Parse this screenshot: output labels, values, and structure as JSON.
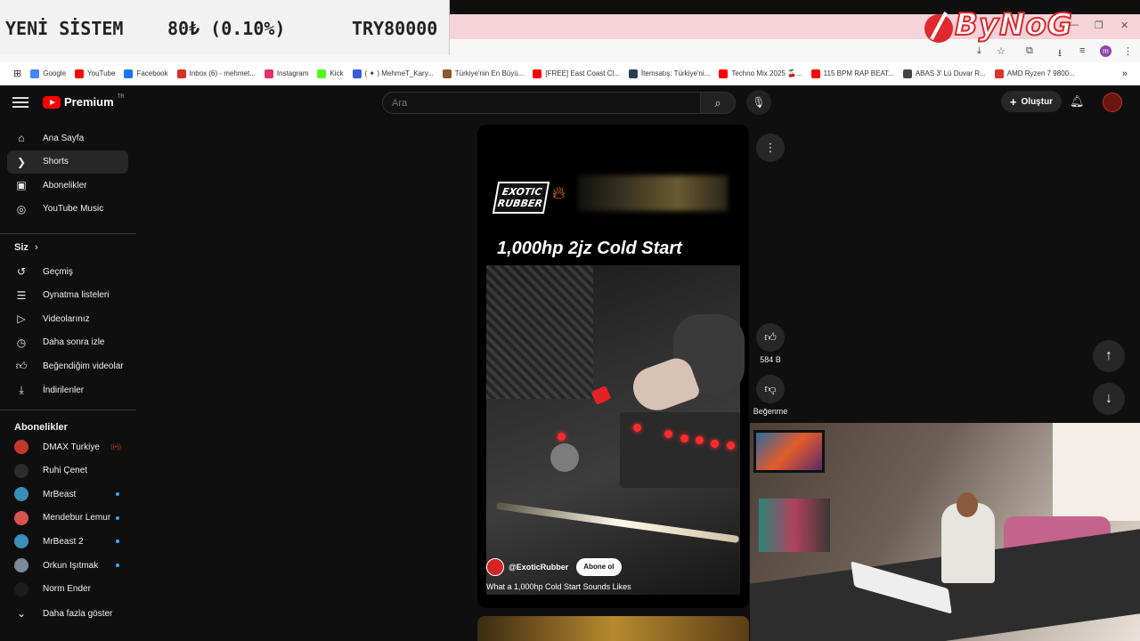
{
  "ticker": {
    "label": "YENİ SİSTEM",
    "price": "80₺ (0.10%)",
    "target": "TRY80000"
  },
  "stream_logo": {
    "text": "ByNoG"
  },
  "bookmarks": [
    {
      "label": "Google",
      "color": "#4285f4"
    },
    {
      "label": "YouTube",
      "color": "#ff0000"
    },
    {
      "label": "Facebook",
      "color": "#1877f2"
    },
    {
      "label": "Inbox (6) - mehmet...",
      "color": "#d93025"
    },
    {
      "label": "Instagram",
      "color": "#e1306c"
    },
    {
      "label": "Kick",
      "color": "#53fc18"
    },
    {
      "label": "( ✦ ) MehmeT_Kary...",
      "color": "#3b5bdb"
    },
    {
      "label": "Türkiye'nin En Büyü...",
      "color": "#8a5a2b"
    },
    {
      "label": "[FREE] East Coast Cl...",
      "color": "#ff0000"
    },
    {
      "label": "İtemsatış: Türkiye'ni...",
      "color": "#2c3e50"
    },
    {
      "label": "Techno Mix 2025 🍒...",
      "color": "#ff0000"
    },
    {
      "label": "115 BPM RAP BEAT...",
      "color": "#ff0000"
    },
    {
      "label": "ABAS 3' Lü Duvar R...",
      "color": "#444444"
    },
    {
      "label": "AMD Ryzen 7 9800...",
      "color": "#e03131"
    }
  ],
  "header": {
    "logo_text": "Premium",
    "logo_sup": "TR",
    "search_placeholder": "Ara",
    "create_label": "Oluştur"
  },
  "sidebar": {
    "main": [
      {
        "label": "Ana Sayfa",
        "icon": "home-icon"
      },
      {
        "label": "Shorts",
        "icon": "shorts-icon"
      },
      {
        "label": "Abonelikler",
        "icon": "subscriptions-icon"
      },
      {
        "label": "YouTube Music",
        "icon": "music-icon"
      }
    ],
    "you_header": "Siz",
    "you": [
      {
        "label": "Geçmiş",
        "icon": "history-icon"
      },
      {
        "label": "Oynatma listeleri",
        "icon": "playlist-icon"
      },
      {
        "label": "Videolarınız",
        "icon": "your-videos-icon"
      },
      {
        "label": "Daha sonra izle",
        "icon": "watch-later-icon"
      },
      {
        "label": "Beğendiğim videolar",
        "icon": "liked-icon"
      },
      {
        "label": "İndirilenler",
        "icon": "download-icon"
      }
    ],
    "subs_header": "Abonelikler",
    "subs": [
      {
        "label": "DMAX Turkiye",
        "color": "#c0392b",
        "badge": "live"
      },
      {
        "label": "Ruhi Çenet",
        "color": "#2c2c2c",
        "badge": "none"
      },
      {
        "label": "MrBeast",
        "color": "#3a8fb7",
        "badge": "dot"
      },
      {
        "label": "Mendebur Lemur",
        "color": "#d9534f",
        "badge": "dot"
      },
      {
        "label": "MrBeast 2",
        "color": "#3a8fb7",
        "badge": "dot"
      },
      {
        "label": "Orkun Işıtmak",
        "color": "#7b8a9a",
        "badge": "dot"
      },
      {
        "label": "Norm Ender",
        "color": "#1c1c1c",
        "badge": "none"
      }
    ],
    "show_more": "Daha fazla göster"
  },
  "short": {
    "brand": "EXOTIC RUBBER",
    "title": "1,000hp 2jz Cold Start",
    "channel": "@ExoticRubber",
    "subscribe": "Abone ol",
    "caption": "What a 1,000hp Cold Start Sounds Likes",
    "likes": "584 B",
    "dislike_label": "Beğenme"
  }
}
